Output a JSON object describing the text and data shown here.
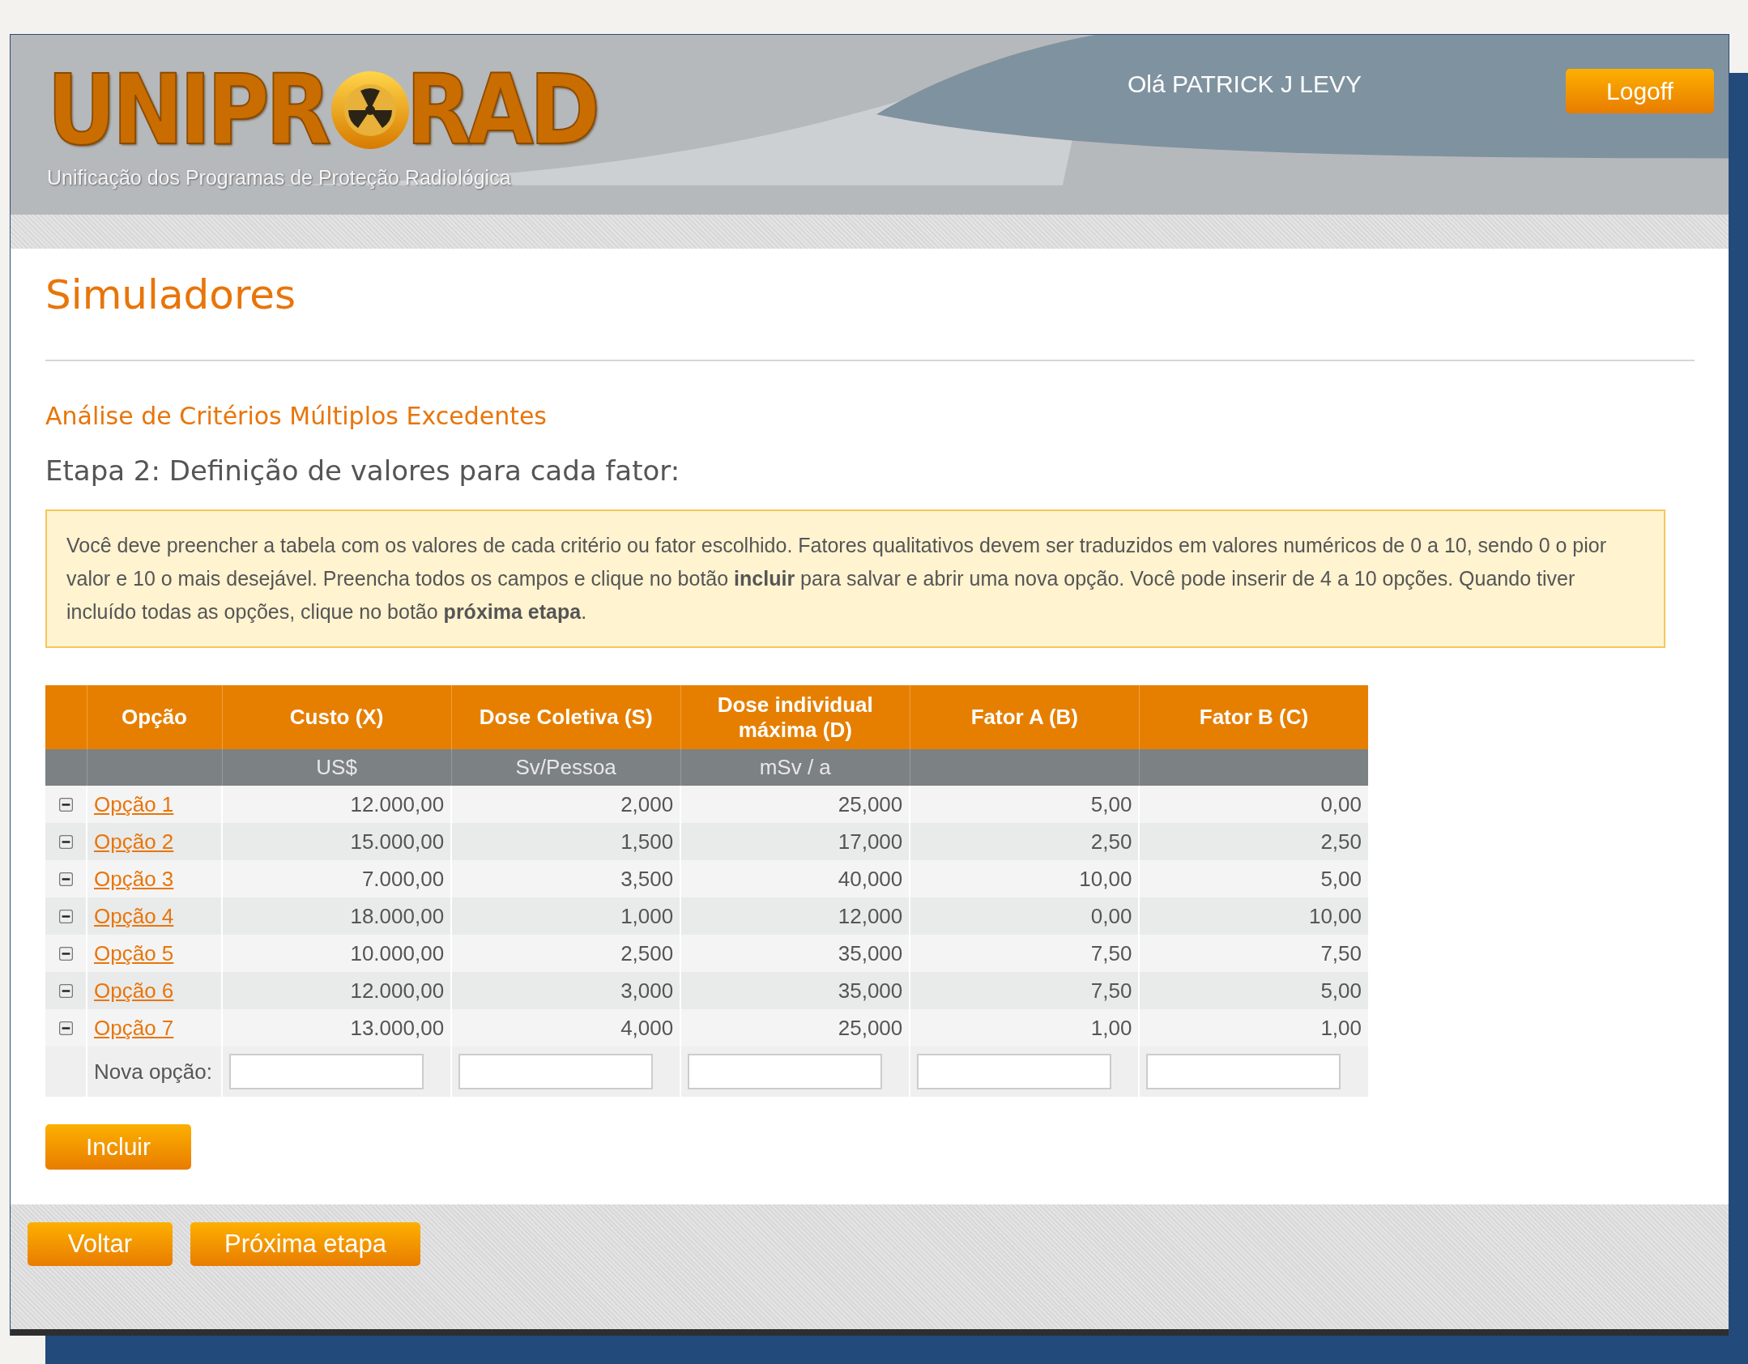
{
  "header": {
    "logo": {
      "before": "UNIPR",
      "after": "RAD"
    },
    "tagline": "Unificação dos Programas de Proteção Radiológica",
    "greeting": "Olá PATRICK J LEVY",
    "logoff": "Logoff"
  },
  "page_title": "Simuladores",
  "subtitle": "Análise de Critérios Múltiplos Excedentes",
  "step_title": "Etapa 2: Definição de valores para cada fator:",
  "note": "Você deve preencher a tabela com os valores de cada critério ou fator escolhido. Fatores qualitativos devem ser traduzidos em valores numéricos de 0 a 10, sendo 0 o pior valor e 10 o mais desejável. Preencha todos os campos e clique no botão **incluir** para salvar e abrir uma nova opção. Você pode inserir de 4 a 10 opções. Quando tiver incluído todas as opções, clique no botão **próxima etapa**.",
  "table": {
    "columns": [
      {
        "label": "Opção"
      },
      {
        "label": "Custo (X)",
        "unit": "US$"
      },
      {
        "label": "Dose Coletiva (S)",
        "unit": "Sv/Pessoa"
      },
      {
        "label": "Dose individual máxima (D)",
        "unit": "mSv / a"
      },
      {
        "label": "Fator A (B)"
      },
      {
        "label": "Fator B (C)"
      }
    ],
    "rows": [
      {
        "name": "Opção 1",
        "values": [
          "12.000,00",
          "2,000",
          "25,000",
          "5,00",
          "0,00"
        ]
      },
      {
        "name": "Opção 2",
        "values": [
          "15.000,00",
          "1,500",
          "17,000",
          "2,50",
          "2,50"
        ]
      },
      {
        "name": "Opção 3",
        "values": [
          "7.000,00",
          "3,500",
          "40,000",
          "10,00",
          "5,00"
        ]
      },
      {
        "name": "Opção 4",
        "values": [
          "18.000,00",
          "1,000",
          "12,000",
          "0,00",
          "10,00"
        ]
      },
      {
        "name": "Opção 5",
        "values": [
          "10.000,00",
          "2,500",
          "35,000",
          "7,50",
          "7,50"
        ]
      },
      {
        "name": "Opção 6",
        "values": [
          "12.000,00",
          "3,000",
          "35,000",
          "7,50",
          "5,00"
        ]
      },
      {
        "name": "Opção 7",
        "values": [
          "13.000,00",
          "4,000",
          "25,000",
          "1,00",
          "1,00"
        ]
      }
    ],
    "new_row": {
      "label": "Nova opção:"
    }
  },
  "include_button": "Incluir",
  "footer_buttons": [
    "Voltar",
    "Próxima etapa"
  ]
}
